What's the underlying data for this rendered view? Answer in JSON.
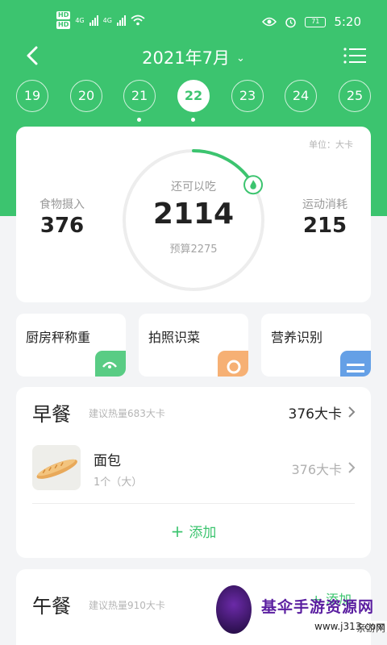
{
  "status_bar": {
    "hd_badge_1": "HD",
    "hd_badge_2": "HD",
    "network_1": "4G",
    "network_2": "4G",
    "battery": "71",
    "time": "5:20"
  },
  "header": {
    "month_label": "2021年7月"
  },
  "days": [
    {
      "label": "19",
      "active": false,
      "has_record": false
    },
    {
      "label": "20",
      "active": false,
      "has_record": false
    },
    {
      "label": "21",
      "active": false,
      "has_record": true
    },
    {
      "label": "22",
      "active": true,
      "has_record": true
    },
    {
      "label": "23",
      "active": false,
      "has_record": false
    },
    {
      "label": "24",
      "active": false,
      "has_record": false
    },
    {
      "label": "25",
      "active": false,
      "has_record": false
    }
  ],
  "summary": {
    "unit_label": "单位：大卡",
    "intake_label": "食物摄入",
    "intake_value": "376",
    "remaining_label": "还可以吃",
    "remaining_value": "2114",
    "budget_label": "预算2275",
    "exercise_label": "运动消耗",
    "exercise_value": "215",
    "ring_progress": 0.165
  },
  "tools": [
    {
      "label": "厨房秤称重",
      "icon": "scale-icon",
      "color": "#3cc46f"
    },
    {
      "label": "拍照识菜",
      "icon": "camera-icon",
      "color": "#f5a35c"
    },
    {
      "label": "营养识别",
      "icon": "document-icon",
      "color": "#4a90e2"
    }
  ],
  "breakfast": {
    "title": "早餐",
    "suggestion": "建议热量683大卡",
    "total_kcal": "376大卡",
    "items": [
      {
        "name": "面包",
        "amount": "1个（大）",
        "kcal": "376大卡"
      }
    ],
    "add_label": "添加"
  },
  "lunch": {
    "title": "午餐",
    "suggestion": "建议热量910大卡",
    "add_label": "添加"
  },
  "watermark": {
    "title": "基伞手游资源网",
    "url": "www.j313.com",
    "subtitle": "亲游网"
  },
  "colors": {
    "brand_green": "#3cc46f",
    "background": "#f3f4f6"
  }
}
